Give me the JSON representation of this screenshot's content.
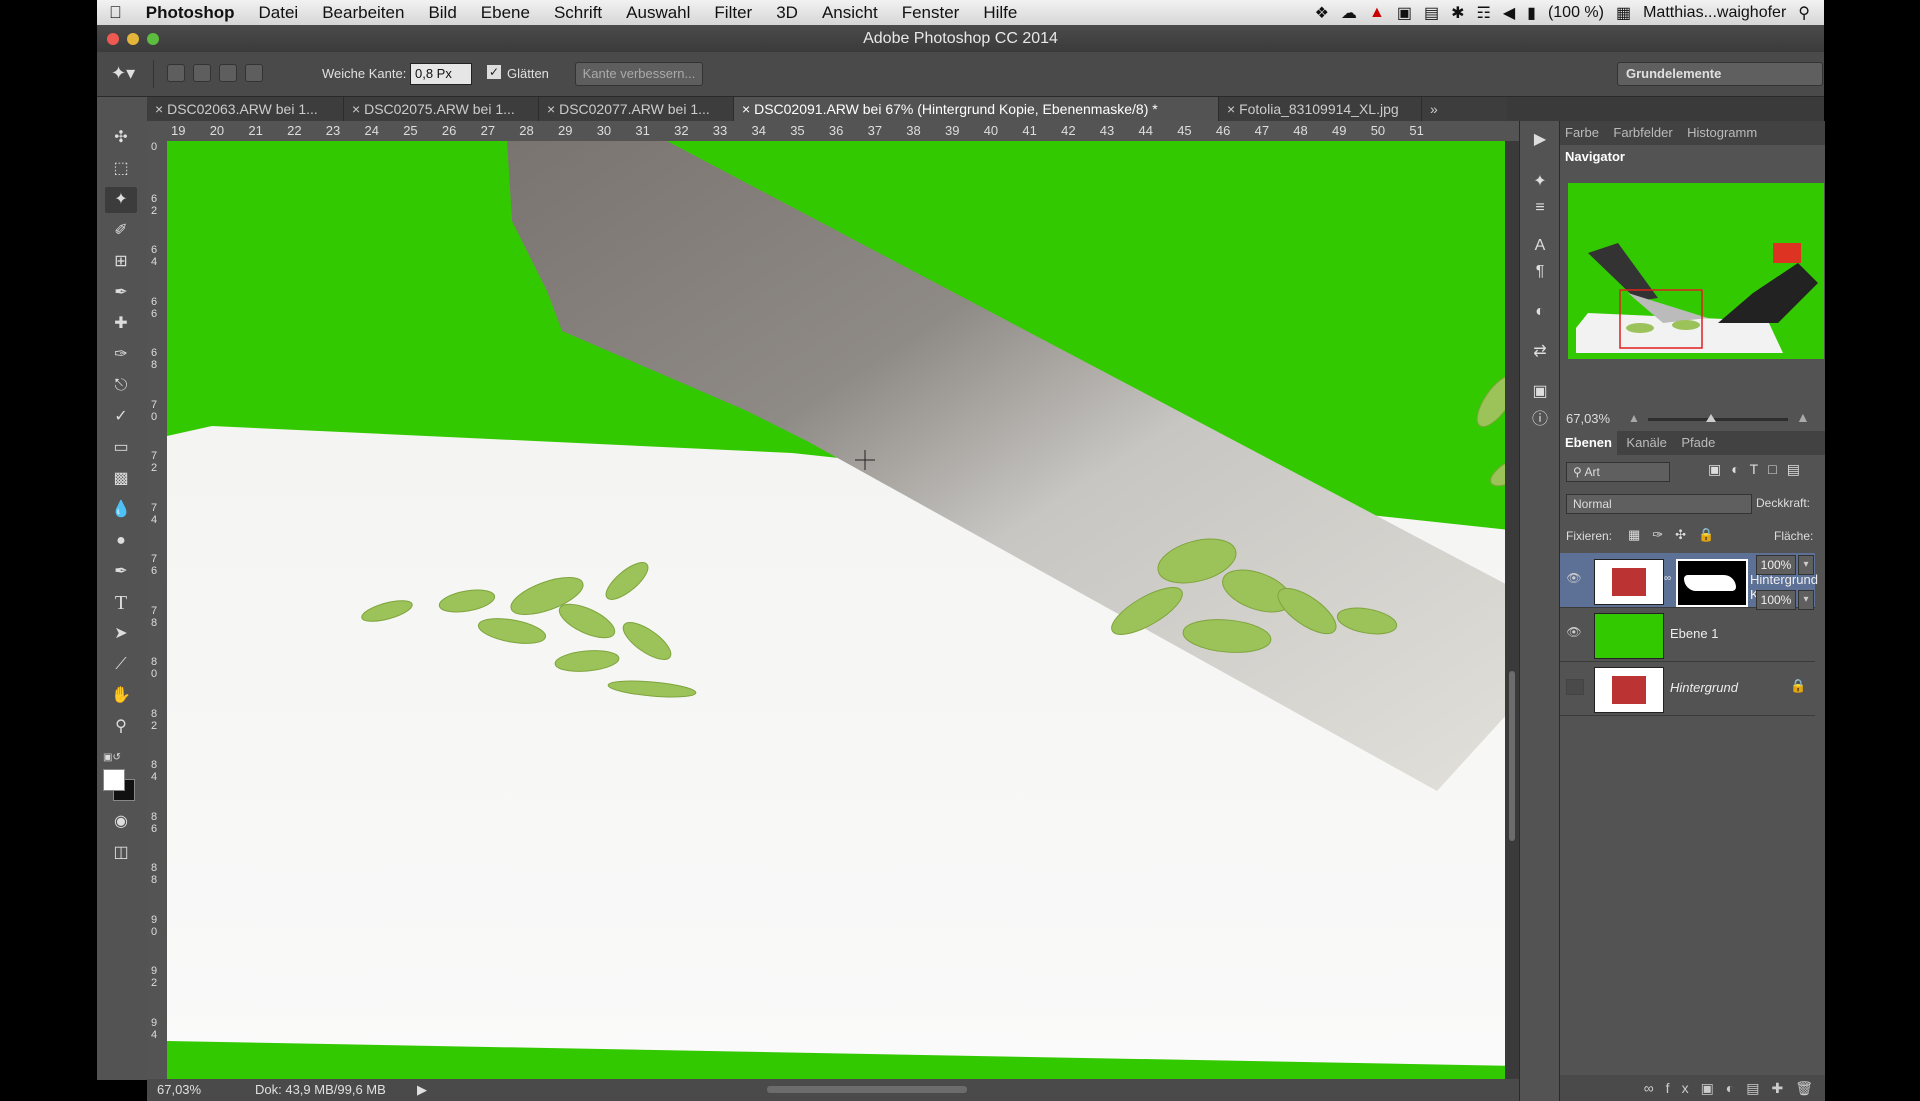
{
  "menubar": {
    "apple": "",
    "app_name": "Photoshop",
    "items": [
      "Datei",
      "Bearbeiten",
      "Bild",
      "Ebene",
      "Schrift",
      "Auswahl",
      "Filter",
      "3D",
      "Ansicht",
      "Fenster",
      "Hilfe"
    ],
    "battery": "(100 %)",
    "user": "Matthias...waighofer"
  },
  "window": {
    "title": "Adobe Photoshop CC 2014"
  },
  "options": {
    "feather_label": "Weiche Kante:",
    "feather_value": "0,8 Px",
    "antialias_label": "Glätten",
    "refine_edge": "Kante verbessern...",
    "workspace": "Grundelemente"
  },
  "doc_tabs": [
    {
      "label": "DSC02063.ARW bei 1..."
    },
    {
      "label": "DSC02075.ARW bei 1..."
    },
    {
      "label": "DSC02077.ARW bei 1..."
    },
    {
      "label": "DSC02091.ARW bei 67% (Hintergrund Kopie, Ebenenmaske/8) *"
    },
    {
      "label": "Fotolia_83109914_XL.jpg"
    }
  ],
  "ruler_h": [
    "19",
    "20",
    "21",
    "22",
    "23",
    "24",
    "25",
    "26",
    "27",
    "28",
    "29",
    "30",
    "31",
    "32",
    "33",
    "34",
    "35",
    "36",
    "37",
    "38",
    "39",
    "40",
    "41",
    "42",
    "43",
    "44",
    "45",
    "46",
    "47",
    "48",
    "49",
    "50",
    "51"
  ],
  "ruler_v": [
    "0",
    "6 2",
    "6 4",
    "6 6",
    "6 8",
    "7 0",
    "7 2",
    "7 4",
    "7 6",
    "7 8",
    "8 0",
    "8 2",
    "8 4",
    "8 6",
    "8 8",
    "9 0",
    "9 2",
    "9 4"
  ],
  "status": {
    "zoom": "67,03%",
    "doc": "Dok: 43,9 MB/99,6 MB"
  },
  "panels": {
    "top_tabs": [
      "Farbe",
      "Farbfelder",
      "Histogramm",
      "Navigator"
    ],
    "navigator_zoom": "67,03%",
    "layer_tabs": [
      "Ebenen",
      "Kanäle",
      "Pfade"
    ],
    "filter_kind": "Art",
    "blend_mode": "Normal",
    "opacity_label": "Deckkraft:",
    "opacity_value": "100%",
    "lock_label": "Fixieren:",
    "fill_label": "Fläche:",
    "fill_value": "100%"
  },
  "layers": [
    {
      "name": "Hintergrund K...",
      "visible": true
    },
    {
      "name": "Ebene 1",
      "visible": true
    },
    {
      "name": "Hintergrund",
      "visible": false
    }
  ],
  "colors": {
    "green_screen": "#33c900",
    "selected_layer": "#5d7196"
  }
}
